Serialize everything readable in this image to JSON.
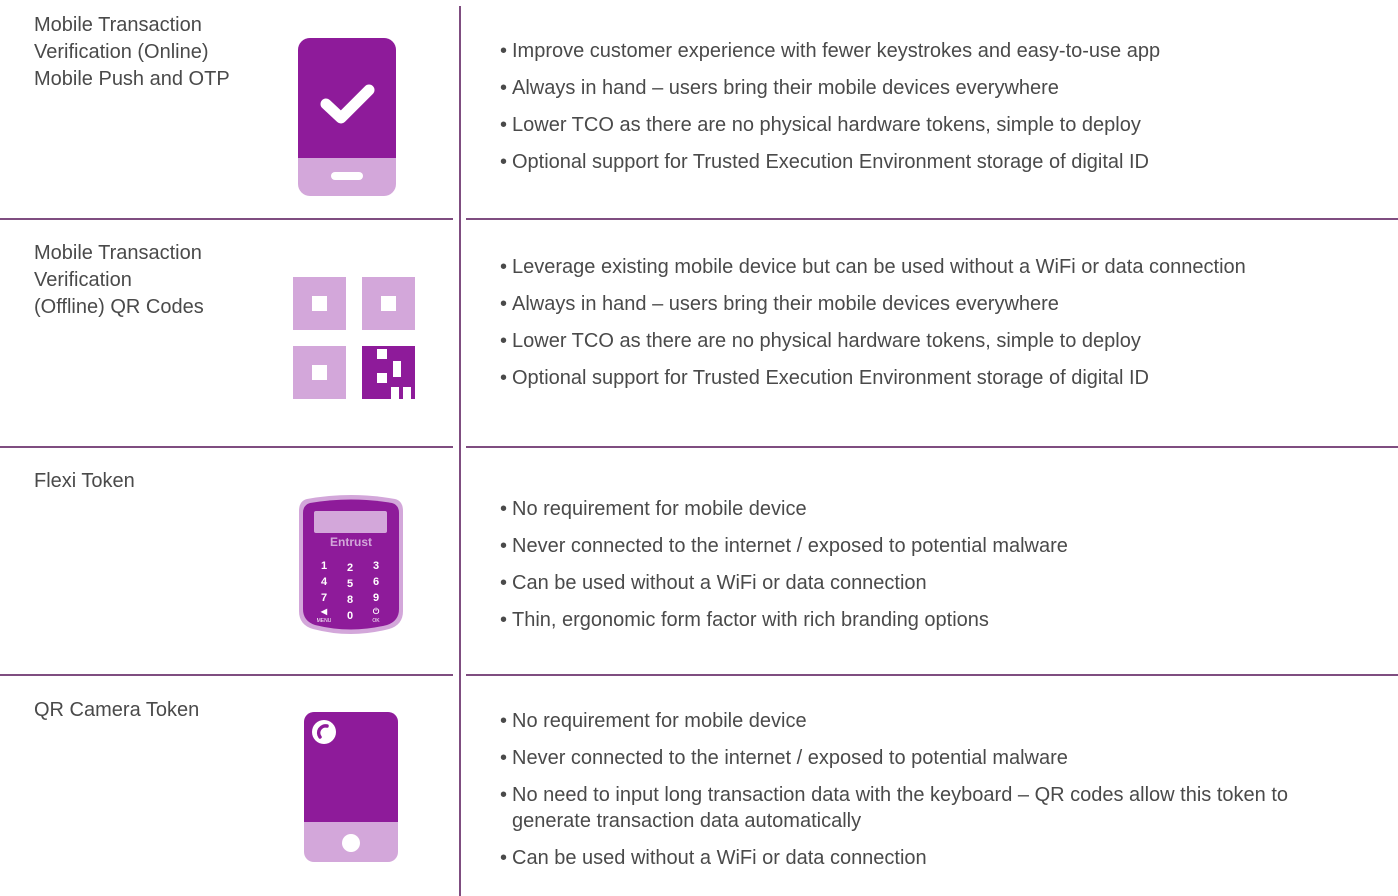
{
  "rows": [
    {
      "label_lines": [
        "Mobile Transaction",
        "Verification (Online)",
        "Mobile Push and OTP"
      ],
      "icon": "phone-checkmark-icon",
      "bullets": [
        "Improve customer experience with fewer keystrokes and easy-to-use app",
        "Always in hand – users bring their mobile devices everywhere",
        "Lower TCO as there are no physical hardware tokens, simple to deploy",
        "Optional support for Trusted Execution Environment storage of digital ID"
      ]
    },
    {
      "label_lines": [
        "Mobile Transaction",
        "Verification",
        "(Offline) QR Codes"
      ],
      "icon": "qr-code-icon",
      "bullets": [
        "Leverage existing mobile device but can be used without a WiFi or data connection",
        "Always in hand – users bring their mobile devices everywhere",
        "Lower TCO as there are no physical hardware tokens, simple to deploy",
        "Optional support for Trusted Execution Environment storage of digital ID"
      ]
    },
    {
      "label_lines": [
        "Flexi Token"
      ],
      "icon": "hardware-token-keypad-icon",
      "device": {
        "brand": "Entrust",
        "keys": [
          "1",
          "2",
          "3",
          "4",
          "5",
          "6",
          "7",
          "8",
          "9",
          "◀",
          "0",
          "⏻"
        ],
        "menu_label": "MENU",
        "ok_label": "OK"
      },
      "bullets": [
        "No requirement for mobile device",
        "Never connected to the internet / exposed to potential malware",
        "Can be used without a WiFi or data connection",
        "Thin, ergonomic form factor with rich branding options"
      ]
    },
    {
      "label_lines": [
        "QR Camera Token"
      ],
      "icon": "camera-token-icon",
      "bullets": [
        "No requirement for mobile device",
        "Never connected to the internet / exposed to potential malware",
        "No need to input long transaction data with the keyboard – QR codes allow this token to generate transaction data automatically",
        "Can be used without a WiFi or data connection"
      ]
    }
  ],
  "colors": {
    "accent": "#8e1b9a",
    "accent_light": "#d3a7da",
    "divider": "#7f4d80",
    "text": "#4a4a4a"
  }
}
